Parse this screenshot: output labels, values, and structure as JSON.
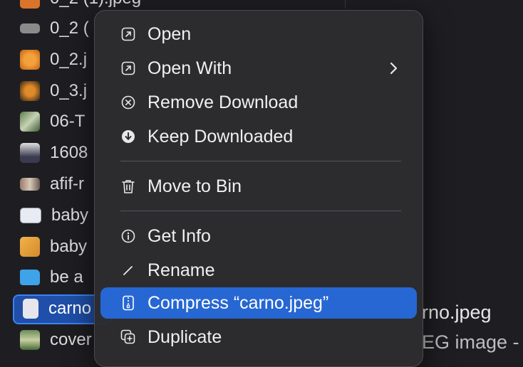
{
  "files": [
    {
      "name": "0_2 (1).jpeg",
      "icon": "image-thumbnail-icon"
    },
    {
      "name": "0_2 (",
      "icon": "image-thumbnail-icon"
    },
    {
      "name": "0_2.j",
      "icon": "image-thumbnail-icon"
    },
    {
      "name": "0_3.j",
      "icon": "image-thumbnail-icon"
    },
    {
      "name": "06-T",
      "icon": "image-thumbnail-icon"
    },
    {
      "name": "1608",
      "icon": "image-thumbnail-icon"
    },
    {
      "name": "afif-r",
      "icon": "image-thumbnail-icon"
    },
    {
      "name": "baby",
      "icon": "image-thumbnail-icon"
    },
    {
      "name": "baby",
      "icon": "image-thumbnail-icon"
    },
    {
      "name": "be a",
      "icon": "folder-icon"
    },
    {
      "name": "carno",
      "icon": "image-thumbnail-icon",
      "selected": true
    },
    {
      "name": "cover",
      "icon": "image-thumbnail-icon"
    }
  ],
  "preview": {
    "filename": "rno.jpeg",
    "kind": "EG image -"
  },
  "context_menu": {
    "open": "Open",
    "open_with": "Open With",
    "remove_download": "Remove Download",
    "keep_downloaded": "Keep Downloaded",
    "move_to_bin": "Move to Bin",
    "get_info": "Get Info",
    "rename": "Rename",
    "compress": "Compress “carno.jpeg”",
    "duplicate": "Duplicate"
  },
  "colors": {
    "highlight": "#2667d3",
    "selection_border": "#3b82f6",
    "menu_bg": "#2c2c30"
  }
}
